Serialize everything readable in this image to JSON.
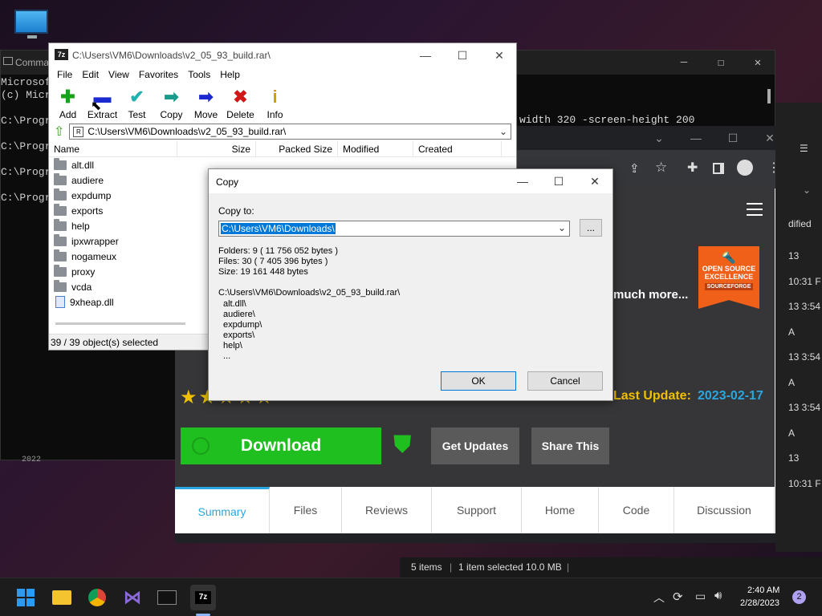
{
  "desktop": {
    "icon": "this-pc-icon"
  },
  "cmd": {
    "title": "Comma",
    "lines": [
      "Microsoft",
      "(c) Micro",
      "",
      "C:\\Progra",
      "",
      "C:\\Progra",
      "",
      "C:\\Progra",
      "",
      "C:\\Progra"
    ],
    "cmdline": "width 320 -screen-height 200",
    "footer": "2022"
  },
  "zip": {
    "title": "C:\\Users\\VM6\\Downloads\\v2_05_93_build.rar\\",
    "menu": [
      "File",
      "Edit",
      "View",
      "Favorites",
      "Tools",
      "Help"
    ],
    "toolbar": [
      {
        "label": "Add",
        "icon": "plus-icon",
        "color": "#1aa01a",
        "glyph": "✚"
      },
      {
        "label": "Extract",
        "icon": "minus-icon",
        "color": "#1a2ad0",
        "glyph": "▬"
      },
      {
        "label": "Test",
        "icon": "check-icon",
        "color": "#20b0b0",
        "glyph": "✔"
      },
      {
        "label": "Copy",
        "icon": "arrow-right-icon",
        "color": "#1a9a8a",
        "glyph": "➡"
      },
      {
        "label": "Move",
        "icon": "arrow-right-icon",
        "color": "#1a2ad0",
        "glyph": "➡"
      },
      {
        "label": "Delete",
        "icon": "x-icon",
        "color": "#d01818",
        "glyph": "✖"
      },
      {
        "label": "Info",
        "icon": "info-icon",
        "color": "#d0a000",
        "glyph": "i"
      }
    ],
    "address": "C:\\Users\\VM6\\Downloads\\v2_05_93_build.rar\\",
    "columns": [
      "Name",
      "Size",
      "Packed Size",
      "Modified",
      "Created"
    ],
    "files": [
      "alt.dll",
      "audiere",
      "expdump",
      "exports",
      "help",
      "ipxwrapper",
      "nogameux",
      "proxy",
      "vcda",
      "9xheap.dll"
    ],
    "status": "39 / 39 object(s) selected"
  },
  "browser": {
    "more": "much more...",
    "badge_line1": "OPEN SOURCE",
    "badge_line2": "EXCELLENCE",
    "badge_brand": "SOURCEFORGE",
    "stars": "★★★★★",
    "last_update_label": "Last Update:",
    "last_update_value": "2023-02-17",
    "download": "Download",
    "get_updates": "Get Updates",
    "share": "Share This",
    "tabs": [
      "Summary",
      "Files",
      "Reviews",
      "Support",
      "Home",
      "Code",
      "Discussion"
    ]
  },
  "explorer": {
    "col": "dified",
    "times": [
      "13 10:31 F",
      "13 3:54 A",
      "13 3:54 A",
      "13 3:54 A",
      "13 10:31 F"
    ],
    "status_items": "5 items",
    "status_sel": "1 item selected  10.0 MB"
  },
  "dialog": {
    "title": "Copy",
    "copy_to_label": "Copy to:",
    "path": "C:\\Users\\VM6\\Downloads\\",
    "browse": "...",
    "info": [
      "Folders: 9    ( 11 756 052 bytes )",
      "Files: 30    ( 7 405 396 bytes )",
      "Size: 19 161 448 bytes"
    ],
    "source": "C:\\Users\\VM6\\Downloads\\v2_05_93_build.rar\\",
    "items": [
      "alt.dll\\",
      "audiere\\",
      "expdump\\",
      "exports\\",
      "help\\",
      "..."
    ],
    "ok": "OK",
    "cancel": "Cancel"
  },
  "taskbar": {
    "time": "2:40 AM",
    "date": "2/28/2023",
    "notif": "2"
  },
  "colors": {
    "accent": "#1ebf1e",
    "link": "#2aa6e0",
    "update": "#f0c000",
    "badge": "#f06018"
  }
}
